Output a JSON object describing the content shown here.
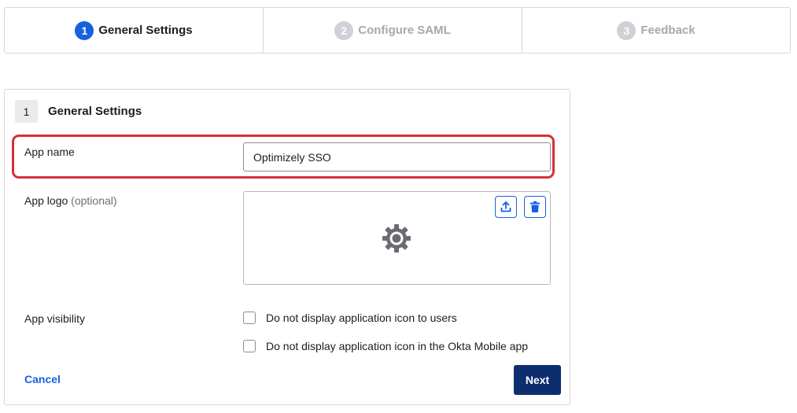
{
  "stepper": {
    "steps": [
      {
        "number": "1",
        "label": "General Settings",
        "state": "active"
      },
      {
        "number": "2",
        "label": "Configure SAML",
        "state": "inactive"
      },
      {
        "number": "3",
        "label": "Feedback",
        "state": "inactive"
      }
    ]
  },
  "section": {
    "number": "1",
    "title": "General Settings"
  },
  "fields": {
    "app_name": {
      "label": "App name",
      "value": "Optimizely SSO"
    },
    "app_logo": {
      "label": "App logo",
      "optional_note": "(optional)",
      "upload_icon": "upload-icon",
      "delete_icon": "trash-icon",
      "placeholder_icon": "gear-icon"
    },
    "app_visibility": {
      "label": "App visibility",
      "options": [
        {
          "label": "Do not display application icon to users",
          "checked": false
        },
        {
          "label": "Do not display application icon in the Okta Mobile app",
          "checked": false
        }
      ]
    }
  },
  "actions": {
    "cancel_label": "Cancel",
    "next_label": "Next"
  },
  "colors": {
    "accent": "#1662dd",
    "primary_button": "#0d2e6e",
    "highlight": "#d6303a",
    "inactive_step": "#d0d0d6"
  }
}
